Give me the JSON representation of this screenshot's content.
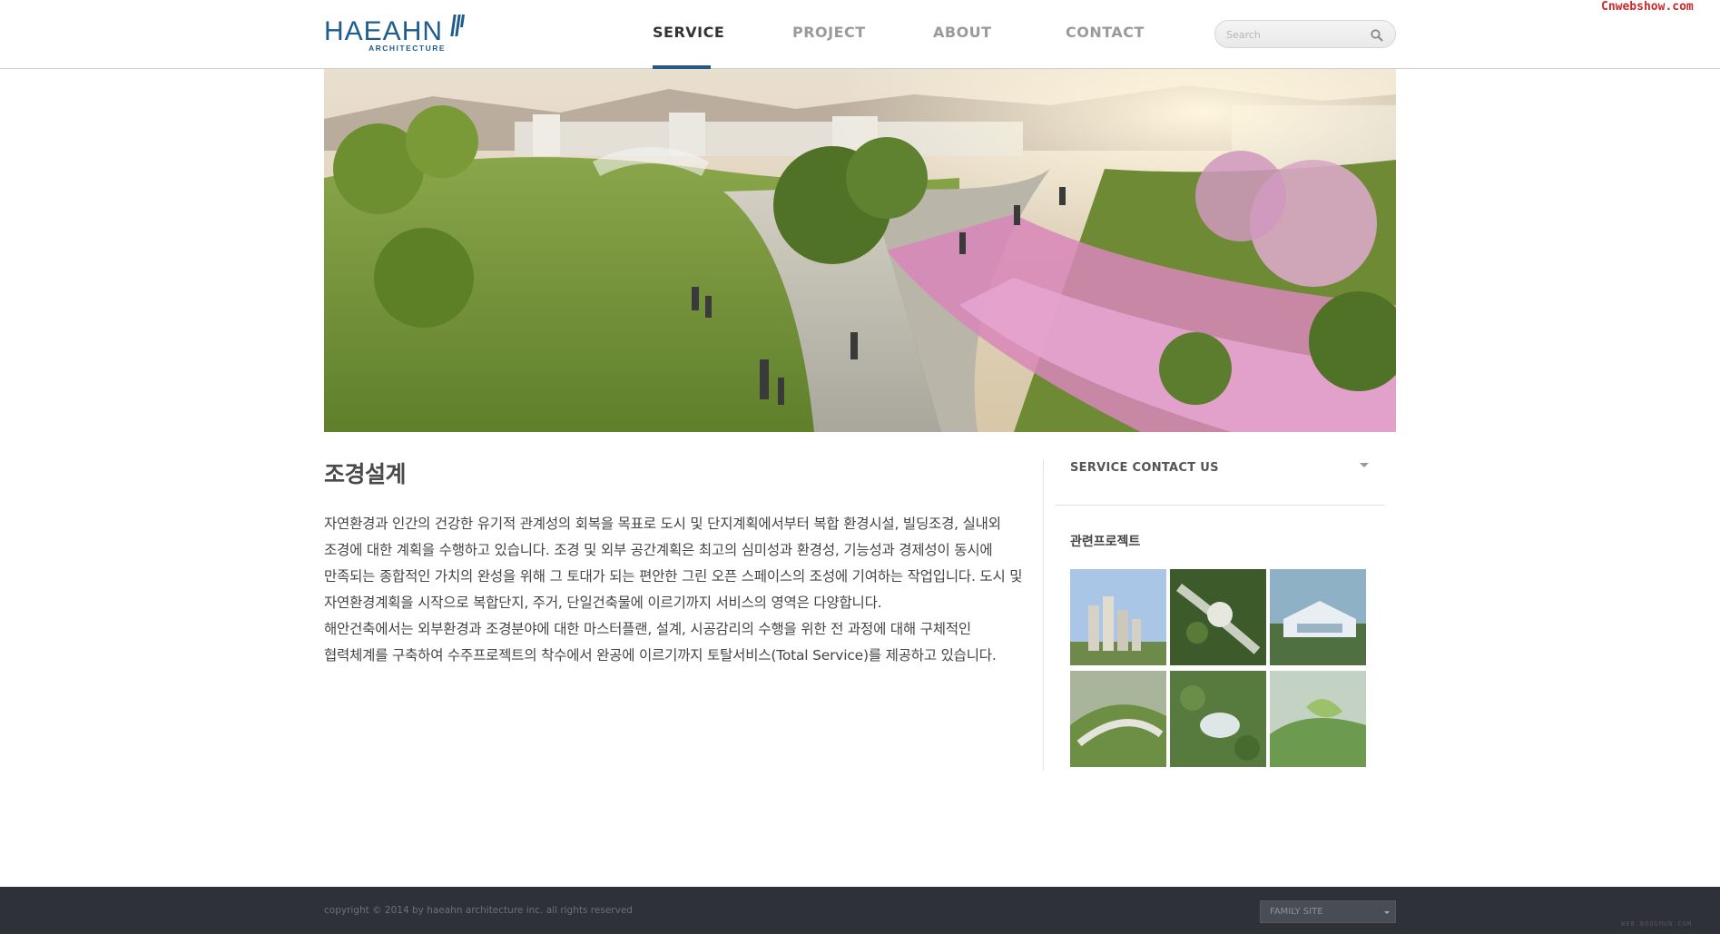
{
  "watermark": "Cnwebshow.com",
  "header": {
    "logo_main": "HAEAHN",
    "logo_sub": "ARCHITECTURE",
    "nav": [
      {
        "label": "SERVICE",
        "active": true
      },
      {
        "label": "PROJECT",
        "active": false
      },
      {
        "label": "ABOUT",
        "active": false
      },
      {
        "label": "CONTACT",
        "active": false
      }
    ],
    "search_placeholder": "Search",
    "search_value": "",
    "accent_color": "#25598a"
  },
  "hero": {
    "icon": "landscape-rendering-image"
  },
  "content": {
    "title": "조경설계",
    "paragraphs": [
      "자연환경과 인간의 건강한 유기적 관계성의 회복을 목표로 도시 및 단지계획에서부터 복합 환경시설, 빌딩조경, 실내외 조경에 대한 계획을 수행하고 있습니다. 조경 및 외부 공간계획은 최고의 심미성과 환경성, 기능성과 경제성이 동시에 만족되는 종합적인 가치의 완성을 위해 그 토대가 되는 편안한 그린 오픈 스페이스의 조성에 기여하는 작업입니다. 도시 및 자연환경계획을 시작으로 복합단지, 주거, 단일건축물에 이르기까지 서비스의 영역은 다양합니다.",
      "해안건축에서는 외부환경과 조경분야에 대한 마스터플랜, 설계, 시공감리의 수행을 위한 전 과정에 대해 구체적인 협력체계를 구축하여 수주프로젝트의 착수에서 완공에 이르기까지 토탈서비스(Total Service)를 제공하고 있습니다."
    ]
  },
  "sidebar": {
    "contact_label": "SERVICE CONTACT US",
    "related_label": "관련프로젝트",
    "thumbnails": [
      {
        "icon": "highrise-towers-thumbnail"
      },
      {
        "icon": "green-aerial-site-thumbnail"
      },
      {
        "icon": "campus-building-thumbnail"
      },
      {
        "icon": "curved-park-aerial-thumbnail"
      },
      {
        "icon": "forest-campus-aerial-thumbnail"
      },
      {
        "icon": "hillside-green-roof-thumbnail"
      }
    ]
  },
  "footer": {
    "copyright": "copyright © 2014 by haeahn architecture inc. all rights reserved",
    "family_site": "FAMILY SITE",
    "mark": "WEB.BOOGMUN.COM"
  }
}
